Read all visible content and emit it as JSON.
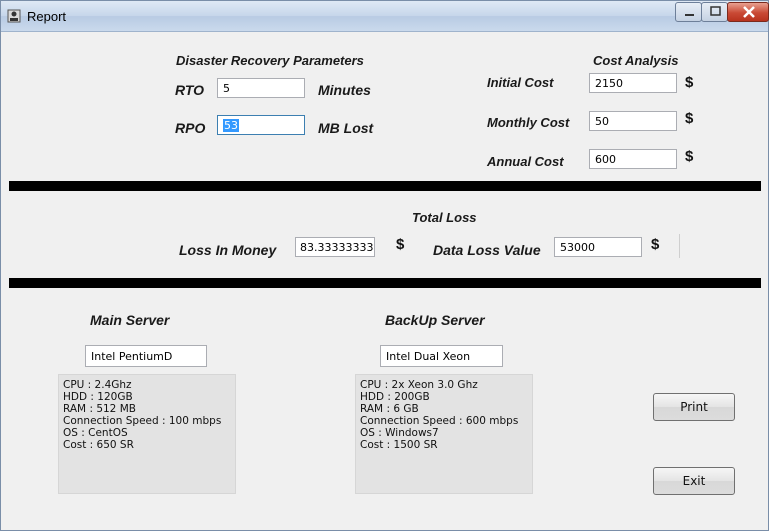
{
  "window": {
    "title": "Report"
  },
  "dr_params": {
    "heading": "Disaster Recovery Parameters",
    "rto_label": "RTO",
    "rto_value": "5",
    "rto_unit": "Minutes",
    "rpo_label": "RPO",
    "rpo_value": "53",
    "rpo_unit": "MB Lost"
  },
  "cost": {
    "heading": "Cost Analysis",
    "initial_label": "Initial Cost",
    "initial_value": "2150",
    "monthly_label": "Monthly Cost",
    "monthly_value": "50",
    "annual_label": "Annual Cost",
    "annual_value": "600",
    "currency": "$"
  },
  "total_loss": {
    "heading": "Total Loss",
    "money_label": "Loss In Money",
    "money_value": "83.3333333333",
    "data_label": "Data Loss Value",
    "data_value": "53000"
  },
  "main_server": {
    "heading": "Main Server",
    "name": "Intel PentiumD",
    "specs": [
      "CPU : 2.4Ghz",
      "HDD : 120GB",
      "RAM : 512 MB",
      "Connection Speed : 100 mbps",
      "OS : CentOS",
      "Cost : 650 SR"
    ]
  },
  "backup_server": {
    "heading": "BackUp Server",
    "name": "Intel Dual Xeon",
    "specs": [
      "CPU : 2x Xeon 3.0 Ghz",
      "HDD : 200GB",
      "RAM : 6 GB",
      "Connection Speed : 600 mbps",
      "OS : Windows7",
      "Cost : 1500 SR"
    ]
  },
  "buttons": {
    "print": "Print",
    "exit": "Exit"
  }
}
